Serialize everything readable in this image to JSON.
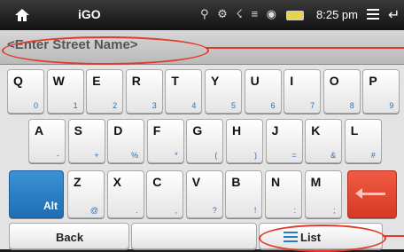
{
  "status_bar": {
    "app_name": "iGO",
    "time": "8:25 pm",
    "status_icons": "⚲ ⚙ ☇ ≡ ◉",
    "back_glyph": "↵"
  },
  "input": {
    "placeholder": "<Enter Street Name>"
  },
  "keyboard": {
    "row1": [
      {
        "main": "Q",
        "sub": "0"
      },
      {
        "main": "W",
        "sub": "1"
      },
      {
        "main": "E",
        "sub": "2"
      },
      {
        "main": "R",
        "sub": "3"
      },
      {
        "main": "T",
        "sub": "4"
      },
      {
        "main": "Y",
        "sub": "5"
      },
      {
        "main": "U",
        "sub": "6"
      },
      {
        "main": "I",
        "sub": "7"
      },
      {
        "main": "O",
        "sub": "8"
      },
      {
        "main": "P",
        "sub": "9"
      }
    ],
    "row2": [
      {
        "main": "A",
        "sub": "-"
      },
      {
        "main": "S",
        "sub": "+"
      },
      {
        "main": "D",
        "sub": "%"
      },
      {
        "main": "F",
        "sub": "*"
      },
      {
        "main": "G",
        "sub": "("
      },
      {
        "main": "H",
        "sub": ")"
      },
      {
        "main": "J",
        "sub": "="
      },
      {
        "main": "K",
        "sub": "&"
      },
      {
        "main": "L",
        "sub": "#"
      }
    ],
    "row3": [
      {
        "main": "Z",
        "sub": "@"
      },
      {
        "main": "X",
        "sub": "."
      },
      {
        "main": "C",
        "sub": ","
      },
      {
        "main": "V",
        "sub": "?"
      },
      {
        "main": "B",
        "sub": "!"
      },
      {
        "main": "N",
        "sub": ":"
      },
      {
        "main": "M",
        "sub": ";"
      }
    ],
    "alt_label": "Alt",
    "back_label": "Back",
    "list_label": "List"
  },
  "colors": {
    "alt_key": "#2a7fc8",
    "delete_key": "#e24a33",
    "annotation": "#e23b2a",
    "sub_label": "#2f6fb4"
  },
  "icons": [
    "home-icon",
    "menu-icon",
    "back-icon",
    "list-icon",
    "backspace-icon"
  ]
}
